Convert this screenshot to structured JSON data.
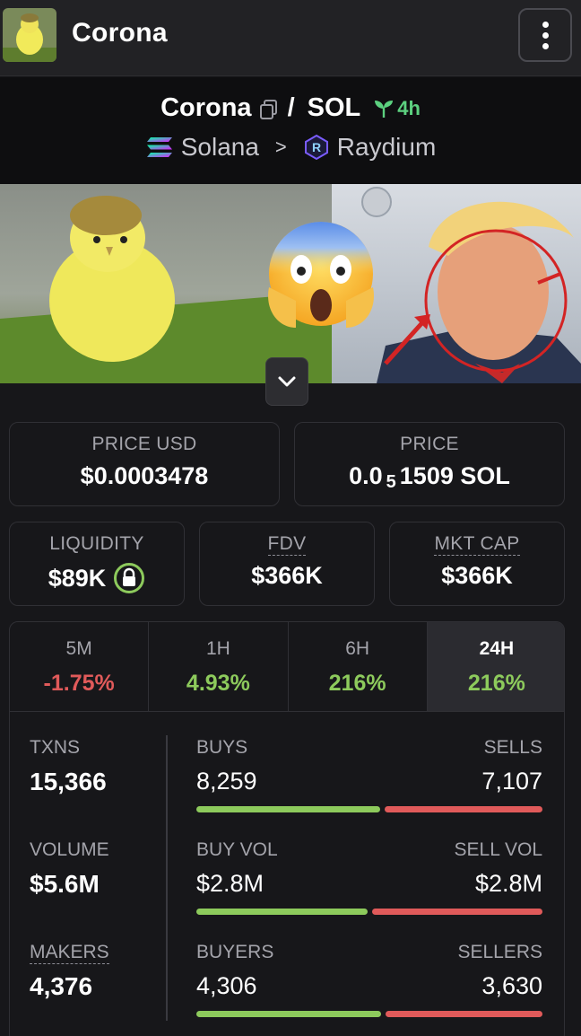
{
  "header": {
    "title": "Corona",
    "menu_icon": "more-vertical-icon"
  },
  "pair": {
    "base": "Corona",
    "quote": "SOL",
    "separator": "/",
    "age": "4h",
    "chain": "Solana",
    "dex": "Raydium"
  },
  "price_usd": {
    "label": "PRICE USD",
    "value": "$0.0003478"
  },
  "price_native": {
    "label": "PRICE",
    "prefix": "0.0",
    "zeros": "5",
    "digits": "1509",
    "unit": "SOL"
  },
  "liquidity": {
    "label": "LIQUIDITY",
    "value": "$89K"
  },
  "fdv": {
    "label": "FDV",
    "value": "$366K"
  },
  "mkt_cap": {
    "label": "MKT CAP",
    "value": "$366K"
  },
  "timeframes": [
    {
      "label": "5M",
      "change": "-1.75%",
      "tone": "neg"
    },
    {
      "label": "1H",
      "change": "4.93%",
      "tone": "pos"
    },
    {
      "label": "6H",
      "change": "216%",
      "tone": "pos"
    },
    {
      "label": "24H",
      "change": "216%",
      "tone": "pos",
      "selected": true
    }
  ],
  "stats": {
    "txns": {
      "label": "TXNS",
      "value": "15,366"
    },
    "volume": {
      "label": "VOLUME",
      "value": "$5.6M"
    },
    "makers": {
      "label": "MAKERS",
      "value": "4,376"
    },
    "buys": {
      "label": "BUYS",
      "value": "8,259",
      "share": 0.537
    },
    "sells": {
      "label": "SELLS",
      "value": "7,107"
    },
    "buy_vol": {
      "label": "BUY VOL",
      "value": "$2.8M",
      "share": 0.5
    },
    "sell_vol": {
      "label": "SELL VOL",
      "value": "$2.8M"
    },
    "buyers": {
      "label": "BUYERS",
      "value": "4,306",
      "share": 0.54
    },
    "sellers": {
      "label": "SELLERS",
      "value": "3,630"
    }
  },
  "colors": {
    "positive": "#8dca5c",
    "negative": "#e05a5a",
    "age": "#5cd07f"
  }
}
